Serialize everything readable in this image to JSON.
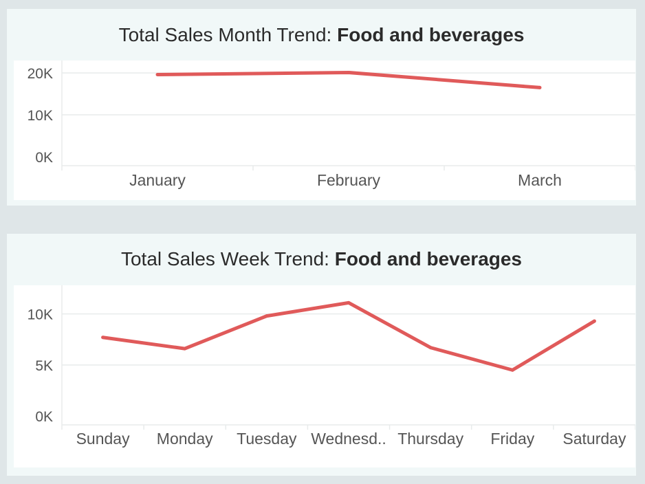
{
  "colors": {
    "line": "#e05a5a",
    "background": "#dfe6e8",
    "panel": "#f1f8f8",
    "plot": "#ffffff",
    "grid": "#e8ebeb"
  },
  "chart_data": [
    {
      "type": "line",
      "title_prefix": "Total Sales Month Trend: ",
      "title_bold": "Food and beverages",
      "categories": [
        "January",
        "February",
        "March"
      ],
      "series": [
        {
          "values": [
            19600,
            20100,
            16500
          ]
        }
      ],
      "ylim": [
        0,
        21000
      ],
      "yticks": [
        0,
        10000,
        20000
      ],
      "ytick_labels": [
        "0K",
        "10K",
        "20K"
      ],
      "grid": true
    },
    {
      "type": "line",
      "title_prefix": "Total Sales Week Trend: ",
      "title_bold": "Food and beverages",
      "categories": [
        "Sunday",
        "Monday",
        "Tuesday",
        "Wednesd..",
        "Thursday",
        "Friday",
        "Saturday"
      ],
      "series": [
        {
          "values": [
            7700,
            6600,
            9800,
            11100,
            6700,
            4500,
            9300
          ]
        }
      ],
      "ylim": [
        0,
        12000
      ],
      "yticks": [
        0,
        5000,
        10000
      ],
      "ytick_labels": [
        "0K",
        "5K",
        "10K"
      ],
      "grid": true
    }
  ]
}
